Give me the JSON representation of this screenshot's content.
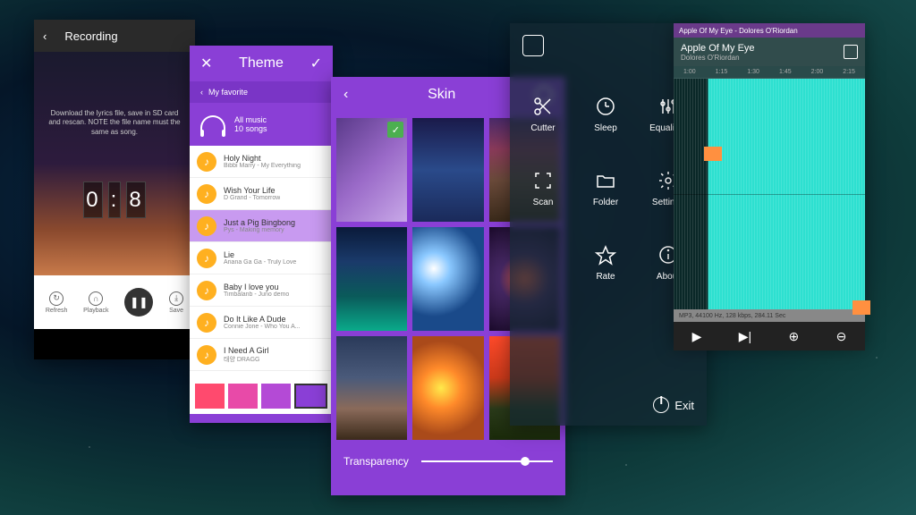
{
  "recording": {
    "title": "Recording",
    "hint": "Download the lyrics file, save in SD card and rescan. NOTE the file name must the same as song.",
    "counter": [
      "0",
      ":",
      "8"
    ],
    "controls": {
      "refresh": "Refresh",
      "playback": "Playback",
      "save": "Save"
    }
  },
  "theme": {
    "title": "Theme",
    "favorites": "My favorite",
    "allmusic_label": "All music",
    "song_count": "10 songs",
    "songs": [
      {
        "name": "Holy Night",
        "artist": "Bibbi Marry - My Everything"
      },
      {
        "name": "Wish Your Life",
        "artist": "D Grand - Tomorrow"
      },
      {
        "name": "Just a Pig Bingbong",
        "artist": "Pys - Making memory"
      },
      {
        "name": "Lie",
        "artist": "Ariana Ga Ga - Truly Love"
      },
      {
        "name": "Baby I love you",
        "artist": "Timbalanb - Juno demo"
      },
      {
        "name": "Do It Like A Dude",
        "artist": "Connie Jone - Who You A..."
      },
      {
        "name": "I Need A Girl",
        "artist": "태양 DRAGG"
      }
    ],
    "swatches": [
      "#ff4a6e",
      "#e84aa8",
      "#b44ad6",
      "#8a3fd6"
    ]
  },
  "skin": {
    "title": "Skin",
    "thumbs": [
      {
        "bg": "linear-gradient(135deg,#5a3a8a,#9a6ac8,#c8a8e8)",
        "selected": true
      },
      {
        "bg": "linear-gradient(180deg,#1a1a4a,#2a4a8a,#1a2a5a)"
      },
      {
        "bg": "linear-gradient(180deg,#4a2a6a 0%,#8a3a5a 30%,#6a4a3a 60%,#3a2a1a 100%)"
      },
      {
        "bg": "linear-gradient(180deg,#0a1a3a,#1a3a6a,#0a5a5a,#0aaa8a)"
      },
      {
        "bg": "radial-gradient(circle at 30% 40%,#fff,#8ac8ff 20%,#1a4a8a 60%)"
      },
      {
        "bg": "radial-gradient(circle at 50% 50%,#ff6a4a,#4a2a6a 40%,#1a0a2a)"
      },
      {
        "bg": "linear-gradient(180deg,#2a3a5a 0%,#4a5a7a 40%,#8a6a5a 70%,#3a2a1a 100%)"
      },
      {
        "bg": "radial-gradient(circle at 40% 50%,#ffea4a,#ff8a2a 30%,#aa4a1a 70%)"
      },
      {
        "bg": "linear-gradient(180deg,#ff4a2a,#cc3a1a 40%,#2a3a1a 70%,#1a2a0a)"
      }
    ],
    "transparency_label": "Transparency"
  },
  "settings": {
    "items": [
      [
        {
          "icon": "scissors",
          "label": "Cutter"
        },
        {
          "icon": "clock",
          "label": "Sleep"
        },
        {
          "icon": "sliders",
          "label": "Equalizer"
        }
      ],
      [
        {
          "icon": "scan",
          "label": "Scan"
        },
        {
          "icon": "folder",
          "label": "Folder"
        },
        {
          "icon": "gear",
          "label": "Settings"
        }
      ],
      [
        {
          "icon": "star",
          "label": "Rate"
        },
        {
          "icon": "info",
          "label": "About"
        }
      ]
    ],
    "exit_label": "Exit"
  },
  "waveform": {
    "window_title": "Apple Of My Eye - Dolores O'Riordan",
    "track": "Apple Of My Eye",
    "artist": "Dolores O'Riordan",
    "ticks": [
      "1:00",
      "1:15",
      "1:30",
      "1:45",
      "2:00",
      "2:15"
    ],
    "info": "MP3, 44100 Hz, 128 kbps, 284.11 Sec"
  }
}
